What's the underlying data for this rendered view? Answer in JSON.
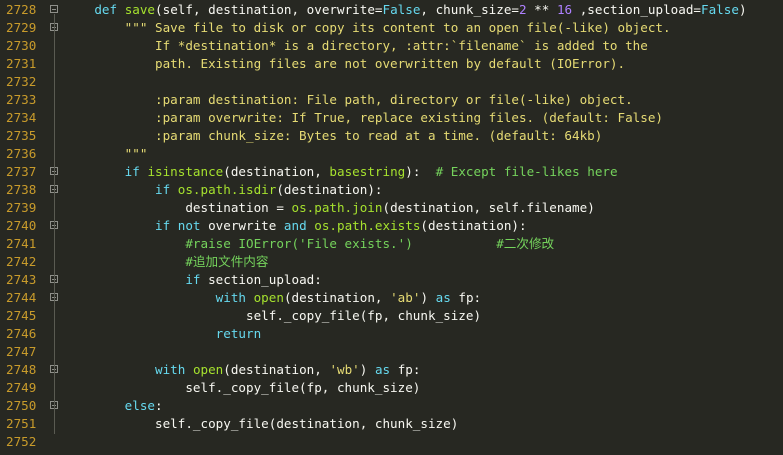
{
  "editor": {
    "lines": [
      {
        "num": "2728",
        "fold": true,
        "tokens": [
          [
            "    ",
            "pl"
          ],
          [
            "def",
            "kw"
          ],
          [
            " ",
            "pl"
          ],
          [
            "save",
            "fn"
          ],
          [
            "(self, destination, overwrite=",
            "pl"
          ],
          [
            "False",
            "const"
          ],
          [
            ", chunk_size=",
            "pl"
          ],
          [
            "2",
            "num"
          ],
          [
            " ** ",
            "pl"
          ],
          [
            "16",
            "num"
          ],
          [
            " ,section_upload=",
            "pl"
          ],
          [
            "False",
            "const"
          ],
          [
            ")",
            "pl"
          ]
        ]
      },
      {
        "num": "2729",
        "fold": true,
        "tokens": [
          [
            "        ",
            "pl"
          ],
          [
            "\"\"\" Save file to disk or copy its content to an open file(-like) object.",
            "str"
          ]
        ]
      },
      {
        "num": "2730",
        "fold": false,
        "tokens": [
          [
            "            ",
            "pl"
          ],
          [
            "If *destination* is a directory, :attr:`filename` is added to the",
            "str"
          ]
        ]
      },
      {
        "num": "2731",
        "fold": false,
        "tokens": [
          [
            "            ",
            "pl"
          ],
          [
            "path. Existing files are not overwritten by default (IOError).",
            "str"
          ]
        ]
      },
      {
        "num": "2732",
        "fold": false,
        "tokens": []
      },
      {
        "num": "2733",
        "fold": false,
        "tokens": [
          [
            "            ",
            "pl"
          ],
          [
            ":param destination: File path, directory or file(-like) object.",
            "str"
          ]
        ]
      },
      {
        "num": "2734",
        "fold": false,
        "tokens": [
          [
            "            ",
            "pl"
          ],
          [
            ":param overwrite: If True, replace existing files. (default: False)",
            "str"
          ]
        ]
      },
      {
        "num": "2735",
        "fold": false,
        "tokens": [
          [
            "            ",
            "pl"
          ],
          [
            ":param chunk_size: Bytes to read at a time. (default: 64kb)",
            "str"
          ]
        ]
      },
      {
        "num": "2736",
        "fold": false,
        "tokens": [
          [
            "        ",
            "pl"
          ],
          [
            "\"\"\"",
            "str"
          ]
        ]
      },
      {
        "num": "2737",
        "fold": true,
        "tokens": [
          [
            "        ",
            "pl"
          ],
          [
            "if",
            "kw"
          ],
          [
            " ",
            "pl"
          ],
          [
            "isinstance",
            "fn"
          ],
          [
            "(destination, ",
            "pl"
          ],
          [
            "basestring",
            "fn"
          ],
          [
            "):  ",
            "pl"
          ],
          [
            "# Except file-likes here",
            "cm"
          ]
        ]
      },
      {
        "num": "2738",
        "fold": true,
        "tokens": [
          [
            "            ",
            "pl"
          ],
          [
            "if",
            "kw"
          ],
          [
            " ",
            "pl"
          ],
          [
            "os.path.isdir",
            "fn"
          ],
          [
            "(destination):",
            "pl"
          ]
        ]
      },
      {
        "num": "2739",
        "fold": false,
        "tokens": [
          [
            "                ",
            "pl"
          ],
          [
            "destination = ",
            "pl"
          ],
          [
            "os.path.join",
            "fn"
          ],
          [
            "(destination, self.filename)",
            "pl"
          ]
        ]
      },
      {
        "num": "2740",
        "fold": true,
        "tokens": [
          [
            "            ",
            "pl"
          ],
          [
            "if",
            "kw"
          ],
          [
            " ",
            "pl"
          ],
          [
            "not",
            "kw"
          ],
          [
            " overwrite ",
            "pl"
          ],
          [
            "and",
            "kw"
          ],
          [
            " ",
            "pl"
          ],
          [
            "os.path.exists",
            "fn"
          ],
          [
            "(destination):",
            "pl"
          ]
        ]
      },
      {
        "num": "2741",
        "fold": false,
        "tokens": [
          [
            "                ",
            "pl"
          ],
          [
            "#raise IOError('File exists.')           #二次修改",
            "cm"
          ]
        ]
      },
      {
        "num": "2742",
        "fold": false,
        "tokens": [
          [
            "                ",
            "pl"
          ],
          [
            "#追加文件内容",
            "cm"
          ]
        ]
      },
      {
        "num": "2743",
        "fold": true,
        "tokens": [
          [
            "                ",
            "pl"
          ],
          [
            "if",
            "kw"
          ],
          [
            " section_upload:",
            "pl"
          ]
        ]
      },
      {
        "num": "2744",
        "fold": true,
        "tokens": [
          [
            "                    ",
            "pl"
          ],
          [
            "with",
            "kw"
          ],
          [
            " ",
            "pl"
          ],
          [
            "open",
            "fn"
          ],
          [
            "(destination, ",
            "pl"
          ],
          [
            "'ab'",
            "str"
          ],
          [
            ") ",
            "pl"
          ],
          [
            "as",
            "kw"
          ],
          [
            " fp:",
            "pl"
          ]
        ]
      },
      {
        "num": "2745",
        "fold": false,
        "tokens": [
          [
            "                        ",
            "pl"
          ],
          [
            "self._copy_file(fp, chunk_size)",
            "pl"
          ]
        ]
      },
      {
        "num": "2746",
        "fold": false,
        "tokens": [
          [
            "                    ",
            "pl"
          ],
          [
            "return",
            "kw"
          ]
        ]
      },
      {
        "num": "2747",
        "fold": false,
        "tokens": []
      },
      {
        "num": "2748",
        "fold": true,
        "tokens": [
          [
            "            ",
            "pl"
          ],
          [
            "with",
            "kw"
          ],
          [
            " ",
            "pl"
          ],
          [
            "open",
            "fn"
          ],
          [
            "(destination, ",
            "pl"
          ],
          [
            "'wb'",
            "str"
          ],
          [
            ") ",
            "pl"
          ],
          [
            "as",
            "kw"
          ],
          [
            " fp:",
            "pl"
          ]
        ]
      },
      {
        "num": "2749",
        "fold": false,
        "tokens": [
          [
            "                ",
            "pl"
          ],
          [
            "self._copy_file(fp, chunk_size)",
            "pl"
          ]
        ]
      },
      {
        "num": "2750",
        "fold": true,
        "tokens": [
          [
            "        ",
            "pl"
          ],
          [
            "else",
            "kw"
          ],
          [
            ":",
            "pl"
          ]
        ]
      },
      {
        "num": "2751",
        "fold": false,
        "tokens": [
          [
            "            ",
            "pl"
          ],
          [
            "self._copy_file(destination, chunk_size)",
            "pl"
          ]
        ]
      },
      {
        "num": "2752",
        "fold": false,
        "tokens": []
      }
    ]
  }
}
